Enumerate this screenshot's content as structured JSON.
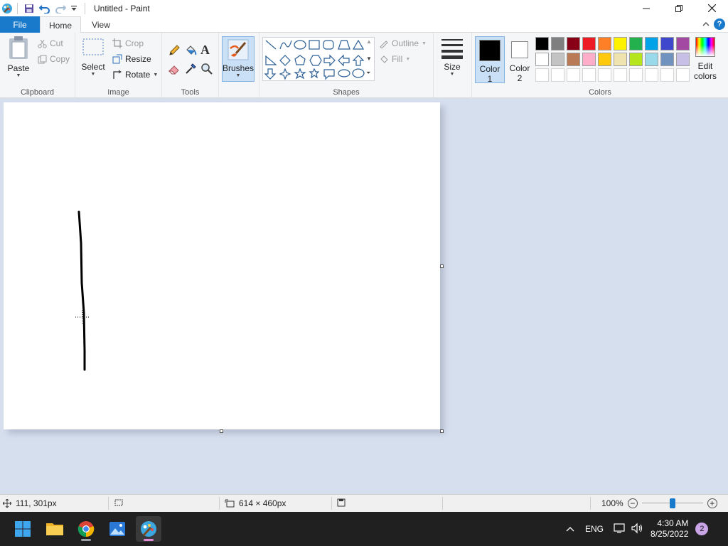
{
  "window": {
    "title": "Untitled - Paint",
    "controls": [
      "minimize",
      "maximize",
      "close"
    ]
  },
  "quick_access": [
    "save-icon",
    "undo-icon",
    "redo-icon",
    "customize-icon"
  ],
  "tabs": {
    "file": "File",
    "home": "Home",
    "view": "View"
  },
  "ribbon": {
    "clipboard": {
      "label": "Clipboard",
      "paste": "Paste",
      "cut": "Cut",
      "copy": "Copy"
    },
    "image": {
      "label": "Image",
      "select": "Select",
      "crop": "Crop",
      "resize": "Resize",
      "rotate": "Rotate"
    },
    "tools": {
      "label": "Tools"
    },
    "brushes": {
      "label": "Brushes"
    },
    "shapes": {
      "label": "Shapes",
      "outline": "Outline",
      "fill": "Fill"
    },
    "size": {
      "label": "Size"
    },
    "colors": {
      "label": "Colors",
      "color1": "Color",
      "color1_num": "1",
      "color2": "Color",
      "color2_num": "2",
      "edit1": "Edit",
      "edit2": "colors",
      "color1_value": "#000000",
      "color2_value": "#ffffff",
      "palette_row1": [
        "#000000",
        "#7f7f7f",
        "#880015",
        "#ed1c24",
        "#ff7f27",
        "#fff200",
        "#22b14c",
        "#00a2e8",
        "#3f48cc",
        "#a349a4"
      ],
      "palette_row2": [
        "#ffffff",
        "#c3c3c3",
        "#b97a57",
        "#ffaec9",
        "#ffc90e",
        "#efe4b0",
        "#b5e61d",
        "#99d9ea",
        "#7092be",
        "#c8bfe7"
      ]
    }
  },
  "statusbar": {
    "cursor_pos": "111, 301px",
    "canvas_size": "614 × 460px",
    "zoom": "100%",
    "zoom_value": 100
  },
  "taskbar": {
    "apps": [
      "start-icon",
      "file-explorer-icon",
      "chrome-icon",
      "photos-icon",
      "paint-icon"
    ],
    "lang": "ENG",
    "time": "4:30 AM",
    "date": "8/25/2022",
    "notifications": "2"
  }
}
